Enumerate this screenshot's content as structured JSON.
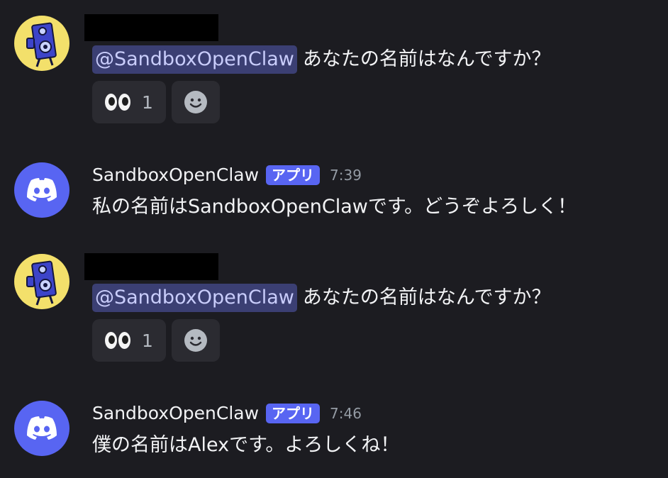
{
  "messages": [
    {
      "mention": "@SandboxOpenClaw",
      "text": "あなたの名前はなんですか？",
      "reaction_count": "1"
    },
    {
      "username": "SandboxOpenClaw",
      "badge": "アプリ",
      "timestamp": "7:39",
      "text": "私の名前はSandboxOpenClawです。どうぞよろしく！"
    },
    {
      "mention": "@SandboxOpenClaw",
      "text": "あなたの名前はなんですか？",
      "reaction_count": "1"
    },
    {
      "username": "SandboxOpenClaw",
      "badge": "アプリ",
      "timestamp": "7:46",
      "text": "僕の名前はAlexです。よろしくね！"
    }
  ],
  "icons": {
    "user_avatar": "robot-speaker-avatar",
    "bot_avatar": "discord-logo-icon",
    "reaction_emoji": "eyes-emoji",
    "add_reaction": "smiley-add-reaction-icon"
  },
  "colors": {
    "background": "#1c1c21",
    "brand": "#5865f2",
    "mention_bg": "#3b3f73",
    "mention_text": "#c9cdfb",
    "timestamp": "#949ba4"
  }
}
